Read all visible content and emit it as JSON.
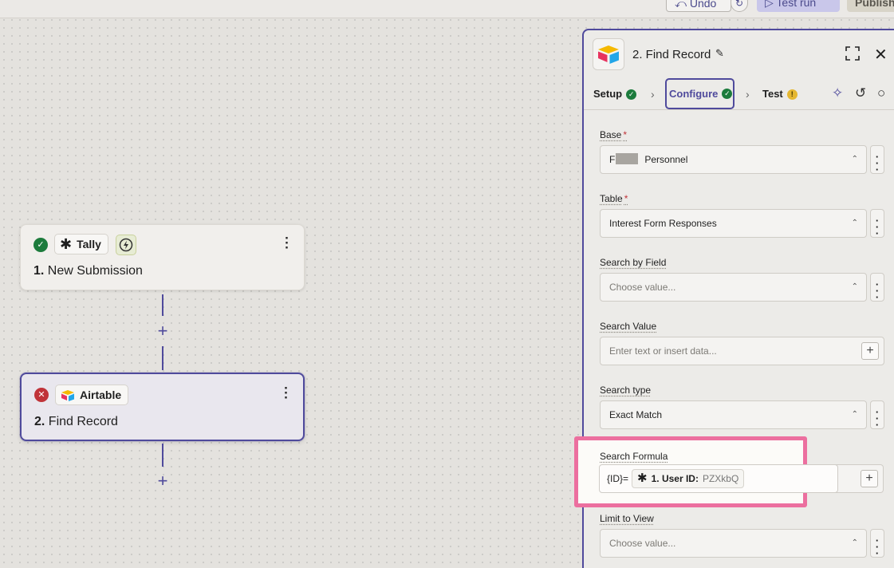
{
  "topbar": {
    "undo_label": "Undo",
    "history_icon": "history-icon",
    "test_run_label": "Test run",
    "publish_label": "Publish"
  },
  "canvas": {
    "steps": [
      {
        "status": "complete",
        "app_name": "Tally",
        "number": "1.",
        "title": "New Submission"
      },
      {
        "status": "error",
        "app_name": "Airtable",
        "number": "2.",
        "title": "Find Record"
      }
    ],
    "add_step_label": "+"
  },
  "panel": {
    "title": "2. Find Record",
    "tabs": [
      {
        "label": "Setup",
        "state": "done"
      },
      {
        "label": "Configure",
        "state": "done"
      },
      {
        "label": "Test",
        "state": "warning"
      }
    ],
    "fields": {
      "base": {
        "label": "Base",
        "required": "*",
        "value_prefix": "F",
        "value": "Personnel"
      },
      "table": {
        "label": "Table",
        "required": "*",
        "value": "Interest Form Responses"
      },
      "search_by_field": {
        "label": "Search by Field",
        "placeholder": "Choose value..."
      },
      "search_value": {
        "label": "Search Value",
        "placeholder": "Enter text or insert data..."
      },
      "search_type": {
        "label": "Search type",
        "value": "Exact Match"
      },
      "search_formula": {
        "label": "Search Formula",
        "prefix": "{ID}=",
        "pill_step": "1. User ID:",
        "pill_value": "PZXkbQ"
      },
      "limit_to_view": {
        "label": "Limit to View",
        "placeholder": "Choose value..."
      }
    }
  },
  "colors": {
    "accent": "#4f4a9c",
    "success": "#1c7b3c",
    "error": "#c03339",
    "warning": "#e5b731",
    "highlight": "#ec6f9f"
  }
}
